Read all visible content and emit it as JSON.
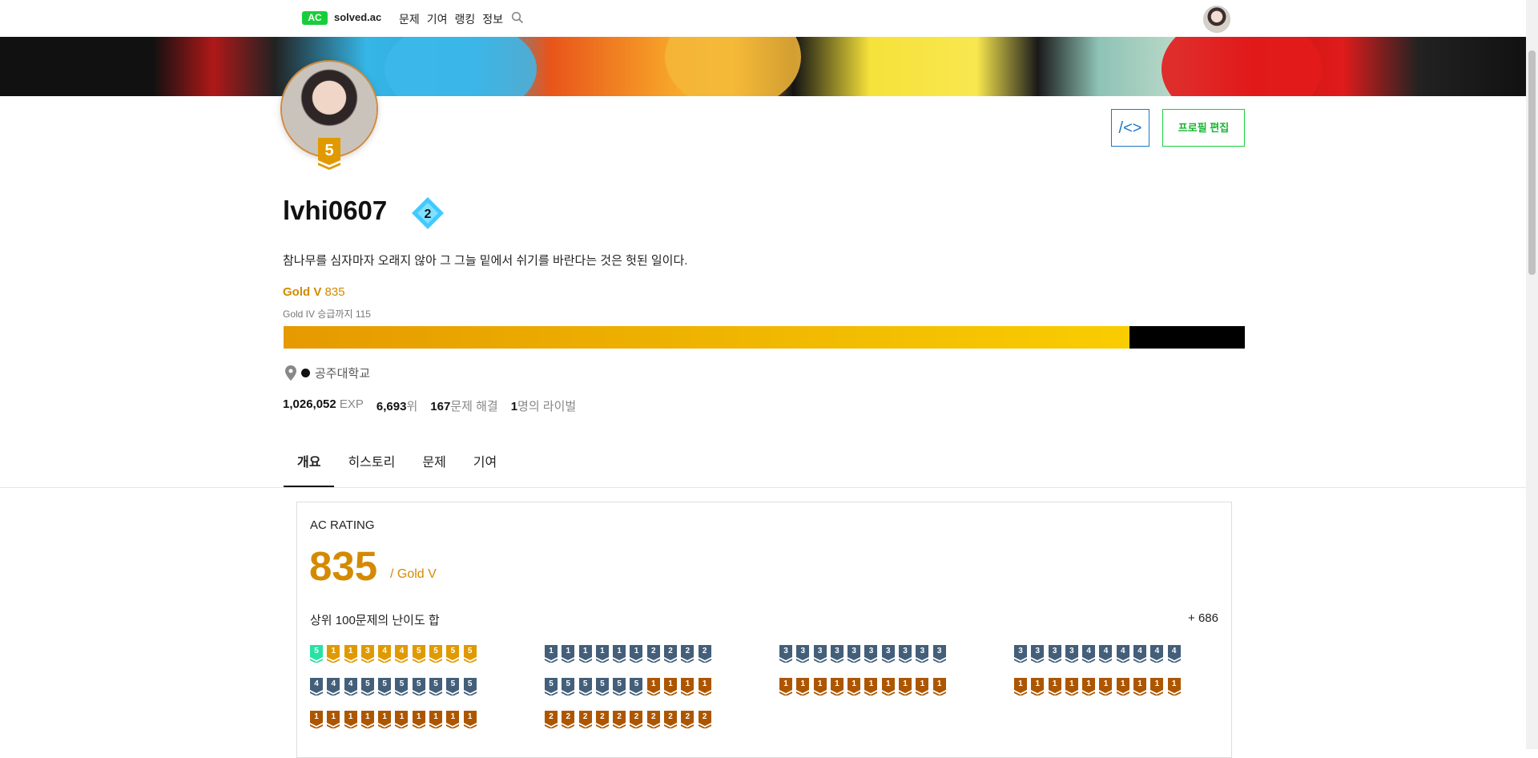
{
  "nav": {
    "logo_badge": "AC",
    "logo_text": "solved.ac",
    "links": [
      "문제",
      "기여",
      "랭킹",
      "정보"
    ]
  },
  "profile": {
    "handle": "lvhi0607",
    "tier_number": "5",
    "class_number": "2",
    "bio": "참나무를 심자마자 오래지 않아 그 그늘 밑에서 쉬기를 바란다는 것은 헛된 일이다.",
    "tier_name": "Gold V",
    "rating": "835",
    "promotion_text": "Gold IV 승급까지 115",
    "progress_fraction": 0.88,
    "school": "공주대학교",
    "exp_value": "1,026,052",
    "exp_label": "EXP",
    "rank_value": "6,693",
    "rank_label": "위",
    "solved_value": "167",
    "solved_label": "문제 해결",
    "rival_value": "1",
    "rival_label": "명의 라이벌",
    "edit_button": "프로필 편집",
    "embed_button": "/<>"
  },
  "tabs": [
    "개요",
    "히스토리",
    "문제",
    "기여"
  ],
  "rating_card": {
    "title": "AC RATING",
    "rating": "835",
    "tier_suffix": "/ Gold V",
    "top100_label": "상위 100문제의 난이도 합",
    "top100_value": "+ 686"
  },
  "colors": {
    "brand": "#17ce3a",
    "gold": "#e09a00",
    "silver": "#435f7a",
    "bronze": "#ad5600",
    "diamond": "#41caff",
    "platinum": "#27e2a4"
  },
  "problem_badges": [
    [
      [
        "P5",
        "G1",
        "G1",
        "G3",
        "G4",
        "G4",
        "G5",
        "G5",
        "G5",
        "G5"
      ],
      [
        "S1",
        "S1",
        "S1",
        "S1",
        "S1",
        "S1",
        "S2",
        "S2",
        "S2",
        "S2"
      ],
      [
        "S3",
        "S3",
        "S3",
        "S3",
        "S3",
        "S3",
        "S3",
        "S3",
        "S3",
        "S3"
      ],
      [
        "S3",
        "S3",
        "S3",
        "S3",
        "S4",
        "S4",
        "S4",
        "S4",
        "S4",
        "S4"
      ]
    ],
    [
      [
        "S4",
        "S4",
        "S4",
        "S5",
        "S5",
        "S5",
        "S5",
        "S5",
        "S5",
        "S5"
      ],
      [
        "S5",
        "S5",
        "S5",
        "S5",
        "S5",
        "S5",
        "B1",
        "B1",
        "B1",
        "B1"
      ],
      [
        "B1",
        "B1",
        "B1",
        "B1",
        "B1",
        "B1",
        "B1",
        "B1",
        "B1",
        "B1"
      ],
      [
        "B1",
        "B1",
        "B1",
        "B1",
        "B1",
        "B1",
        "B1",
        "B1",
        "B1",
        "B1"
      ]
    ],
    [
      [
        "B1",
        "B1",
        "B1",
        "B1",
        "B1",
        "B1",
        "B1",
        "B1",
        "B1",
        "B1"
      ],
      [
        "B2",
        "B2",
        "B2",
        "B2",
        "B2",
        "B2",
        "B2",
        "B2",
        "B2",
        "B2"
      ]
    ]
  ]
}
